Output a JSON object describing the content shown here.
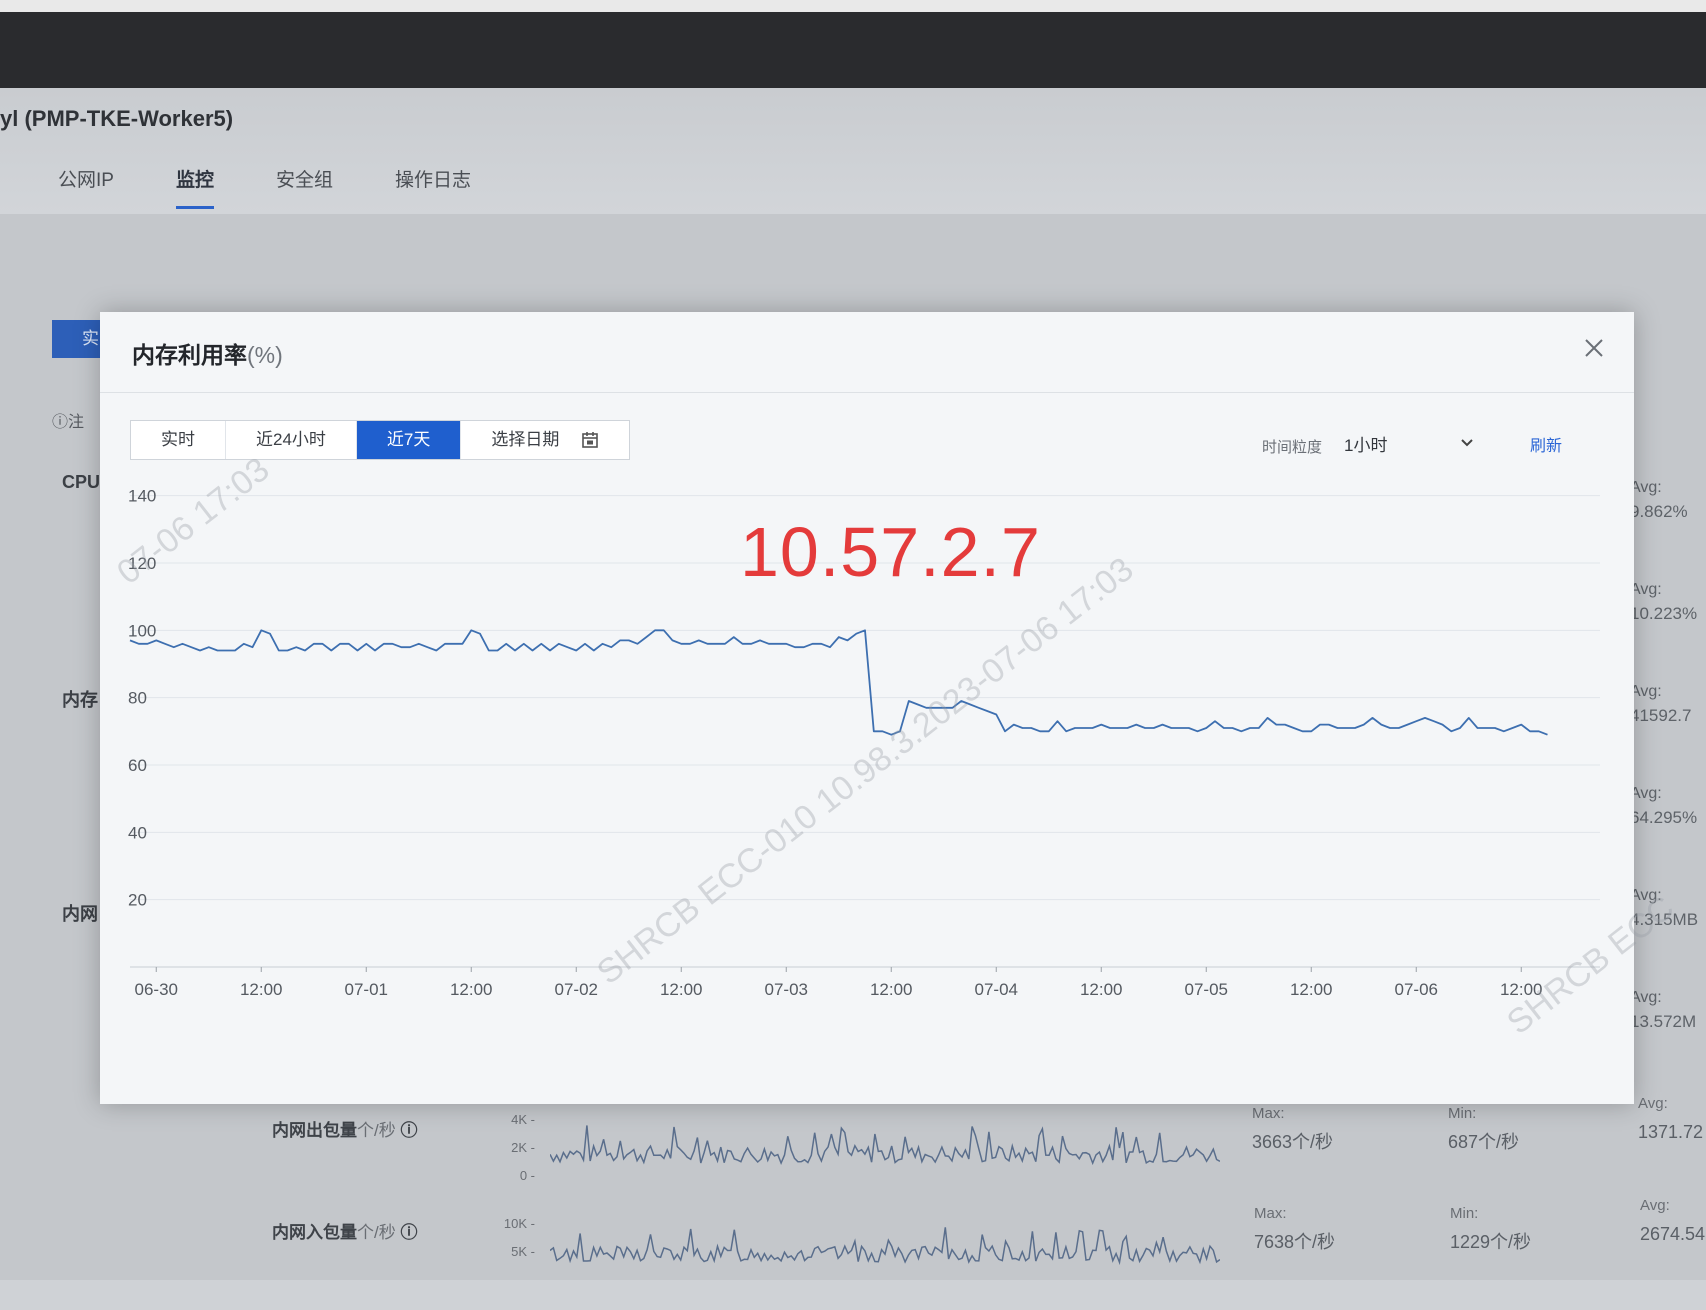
{
  "page": {
    "instance_title": "yl (PMP-TKE-Worker5)",
    "tabs": [
      "公网IP",
      "监控",
      "安全组",
      "操作日志"
    ],
    "active_tab": "监控",
    "left_button_label": "实",
    "note_label": "ⓘ注",
    "left_labels": [
      "CPU",
      "内存",
      "内网"
    ],
    "avg_items": [
      {
        "label": "Avg:",
        "value": "9.862%"
      },
      {
        "label": "Avg:",
        "value": "10.223%"
      },
      {
        "label": "Avg:",
        "value": "41592.7"
      },
      {
        "label": "Avg:",
        "value": "64.295%"
      },
      {
        "label": "Avg:",
        "value": "4.315MB"
      },
      {
        "label": "Avg:",
        "value": "13.572M"
      }
    ],
    "bottom_rows": [
      {
        "name": "内网出包量",
        "unit": "个/秒",
        "ticks": [
          "4K -",
          "2K -",
          "0 -"
        ],
        "max_label": "Max:",
        "max_value": "3663个/秒",
        "min_label": "Min:",
        "min_value": "687个/秒",
        "avg_label": "Avg:",
        "avg_value": "1371.72"
      },
      {
        "name": "内网入包量",
        "unit": "个/秒",
        "ticks": [
          "10K -",
          "5K -"
        ],
        "max_label": "Max:",
        "max_value": "7638个/秒",
        "min_label": "Min:",
        "min_value": "1229个/秒",
        "avg_label": "Avg:",
        "avg_value": "2674.54"
      }
    ]
  },
  "modal": {
    "title": "内存利用率",
    "title_unit": "(%)",
    "range_buttons": [
      "实时",
      "近24小时",
      "近7天",
      "选择日期"
    ],
    "active_range": "近7天",
    "granularity_label": "时间粒度",
    "granularity_value": "1小时",
    "refresh_label": "刷新",
    "ip_overlay": "10.57.2.7",
    "watermarks": [
      "07-06 17:03",
      "SHRCB ECC-010 10.98.3.2023-07-06 17:03",
      "SHRCB ECC"
    ]
  },
  "chart_data": {
    "type": "line",
    "title": "内存利用率(%)",
    "xlabel": "",
    "ylabel": "",
    "ylim": [
      0,
      150
    ],
    "yticks": [
      20,
      40,
      60,
      80,
      100,
      120,
      140
    ],
    "xlim": [
      0,
      168
    ],
    "xticks": [
      {
        "t": 3,
        "label": "06-30"
      },
      {
        "t": 15,
        "label": "12:00"
      },
      {
        "t": 27,
        "label": "07-01"
      },
      {
        "t": 39,
        "label": "12:00"
      },
      {
        "t": 51,
        "label": "07-02"
      },
      {
        "t": 63,
        "label": "12:00"
      },
      {
        "t": 75,
        "label": "07-03"
      },
      {
        "t": 87,
        "label": "12:00"
      },
      {
        "t": 99,
        "label": "07-04"
      },
      {
        "t": 111,
        "label": "12:00"
      },
      {
        "t": 123,
        "label": "07-05"
      },
      {
        "t": 135,
        "label": "12:00"
      },
      {
        "t": 147,
        "label": "07-06"
      },
      {
        "t": 159,
        "label": "12:00"
      }
    ],
    "series": [
      {
        "color": "#3d6fb0",
        "points": [
          [
            0,
            97
          ],
          [
            1,
            96
          ],
          [
            2,
            96
          ],
          [
            3,
            97
          ],
          [
            4,
            96
          ],
          [
            5,
            95
          ],
          [
            6,
            96
          ],
          [
            7,
            95
          ],
          [
            8,
            94
          ],
          [
            9,
            95
          ],
          [
            10,
            94
          ],
          [
            11,
            94
          ],
          [
            12,
            94
          ],
          [
            13,
            96
          ],
          [
            14,
            95
          ],
          [
            15,
            100
          ],
          [
            16,
            99
          ],
          [
            17,
            94
          ],
          [
            18,
            94
          ],
          [
            19,
            95
          ],
          [
            20,
            94
          ],
          [
            21,
            96
          ],
          [
            22,
            96
          ],
          [
            23,
            94
          ],
          [
            24,
            96
          ],
          [
            25,
            96
          ],
          [
            26,
            94
          ],
          [
            27,
            96
          ],
          [
            28,
            94
          ],
          [
            29,
            96
          ],
          [
            30,
            96
          ],
          [
            31,
            95
          ],
          [
            32,
            95
          ],
          [
            33,
            96
          ],
          [
            34,
            95
          ],
          [
            35,
            94
          ],
          [
            36,
            96
          ],
          [
            37,
            96
          ],
          [
            38,
            96
          ],
          [
            39,
            100
          ],
          [
            40,
            99
          ],
          [
            41,
            94
          ],
          [
            42,
            94
          ],
          [
            43,
            96
          ],
          [
            44,
            94
          ],
          [
            45,
            96
          ],
          [
            46,
            94
          ],
          [
            47,
            96
          ],
          [
            48,
            94
          ],
          [
            49,
            96
          ],
          [
            50,
            95
          ],
          [
            51,
            94
          ],
          [
            52,
            96
          ],
          [
            53,
            94
          ],
          [
            54,
            96
          ],
          [
            55,
            95
          ],
          [
            56,
            97
          ],
          [
            57,
            97
          ],
          [
            58,
            96
          ],
          [
            59,
            98
          ],
          [
            60,
            100
          ],
          [
            61,
            100
          ],
          [
            62,
            97
          ],
          [
            63,
            96
          ],
          [
            64,
            96
          ],
          [
            65,
            97
          ],
          [
            66,
            96
          ],
          [
            67,
            96
          ],
          [
            68,
            96
          ],
          [
            69,
            98
          ],
          [
            70,
            96
          ],
          [
            71,
            96
          ],
          [
            72,
            97
          ],
          [
            73,
            96
          ],
          [
            74,
            96
          ],
          [
            75,
            96
          ],
          [
            76,
            95
          ],
          [
            77,
            95
          ],
          [
            78,
            96
          ],
          [
            79,
            96
          ],
          [
            80,
            95
          ],
          [
            81,
            98
          ],
          [
            82,
            97
          ],
          [
            83,
            99
          ],
          [
            84,
            100
          ],
          [
            85,
            70
          ],
          [
            86,
            70
          ],
          [
            87,
            69
          ],
          [
            88,
            70
          ],
          [
            89,
            79
          ],
          [
            90,
            78
          ],
          [
            91,
            77
          ],
          [
            92,
            77
          ],
          [
            93,
            77
          ],
          [
            94,
            77
          ],
          [
            95,
            79
          ],
          [
            96,
            78
          ],
          [
            97,
            77
          ],
          [
            98,
            76
          ],
          [
            99,
            75
          ],
          [
            100,
            70
          ],
          [
            101,
            72
          ],
          [
            102,
            71
          ],
          [
            103,
            71
          ],
          [
            104,
            70
          ],
          [
            105,
            70
          ],
          [
            106,
            73
          ],
          [
            107,
            70
          ],
          [
            108,
            71
          ],
          [
            109,
            71
          ],
          [
            110,
            71
          ],
          [
            111,
            72
          ],
          [
            112,
            71
          ],
          [
            113,
            71
          ],
          [
            114,
            71
          ],
          [
            115,
            72
          ],
          [
            116,
            71
          ],
          [
            117,
            71
          ],
          [
            118,
            72
          ],
          [
            119,
            71
          ],
          [
            120,
            71
          ],
          [
            121,
            71
          ],
          [
            122,
            70
          ],
          [
            123,
            71
          ],
          [
            124,
            73
          ],
          [
            125,
            71
          ],
          [
            126,
            71
          ],
          [
            127,
            70
          ],
          [
            128,
            71
          ],
          [
            129,
            71
          ],
          [
            130,
            74
          ],
          [
            131,
            72
          ],
          [
            132,
            72
          ],
          [
            133,
            71
          ],
          [
            134,
            70
          ],
          [
            135,
            70
          ],
          [
            136,
            72
          ],
          [
            137,
            72
          ],
          [
            138,
            71
          ],
          [
            139,
            71
          ],
          [
            140,
            71
          ],
          [
            141,
            72
          ],
          [
            142,
            74
          ],
          [
            143,
            72
          ],
          [
            144,
            71
          ],
          [
            145,
            71
          ],
          [
            146,
            72
          ],
          [
            147,
            73
          ],
          [
            148,
            74
          ],
          [
            149,
            73
          ],
          [
            150,
            72
          ],
          [
            151,
            70
          ],
          [
            152,
            71
          ],
          [
            153,
            74
          ],
          [
            154,
            71
          ],
          [
            155,
            71
          ],
          [
            156,
            71
          ],
          [
            157,
            70
          ],
          [
            158,
            71
          ],
          [
            159,
            72
          ],
          [
            160,
            70
          ],
          [
            161,
            70
          ],
          [
            162,
            69
          ]
        ]
      }
    ]
  }
}
